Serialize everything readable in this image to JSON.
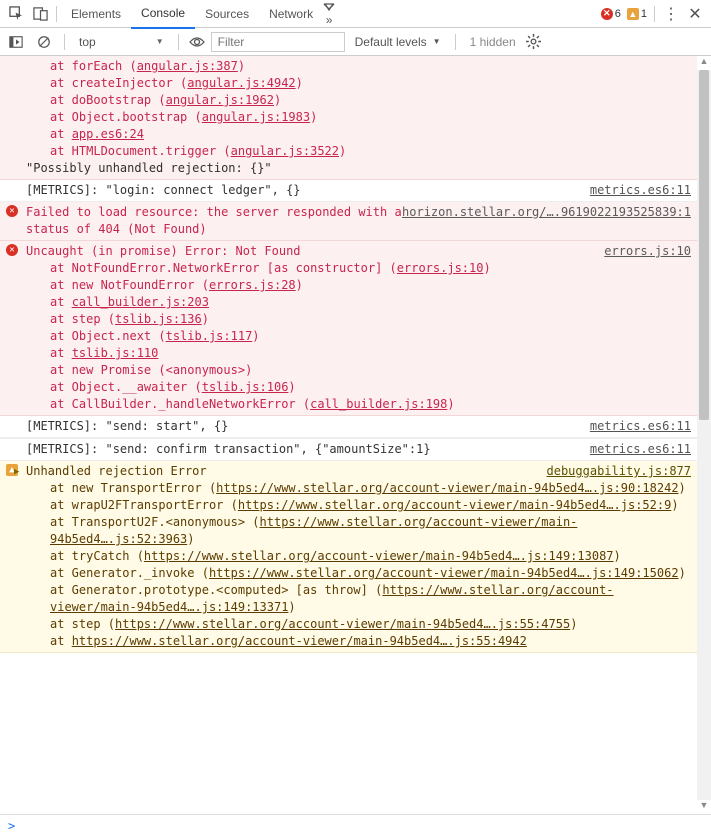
{
  "toolbar": {
    "tabs": [
      "Elements",
      "Console",
      "Sources",
      "Network"
    ],
    "active_tab": 1,
    "error_count": "6",
    "warn_count": "1"
  },
  "filterbar": {
    "context": "top",
    "filter_placeholder": "Filter",
    "levels": "Default levels",
    "hidden": "1 hidden"
  },
  "m0": {
    "l1a": "at forEach (",
    "l1b": "angular.js:387",
    "l1c": ")",
    "l2a": "at createInjector (",
    "l2b": "angular.js:4942",
    "l2c": ")",
    "l3a": "at doBootstrap (",
    "l3b": "angular.js:1962",
    "l3c": ")",
    "l4a": "at Object.bootstrap (",
    "l4b": "angular.js:1983",
    "l4c": ")",
    "l5a": "at ",
    "l5b": "app.es6:24",
    "l6a": "at HTMLDocument.trigger (",
    "l6b": "angular.js:3522",
    "l6c": ")",
    "l7": "\"Possibly unhandled rejection: {}\""
  },
  "m1": {
    "text": "[METRICS]: \"login: connect ledger\", {}",
    "src": "metrics.es6:11"
  },
  "m2": {
    "text": "Failed to load resource: the server responded with a status of 404 (Not Found)",
    "src": "horizon.stellar.org/….9619022193525839:1"
  },
  "m3": {
    "head": "Uncaught (in promise) Error: Not Found",
    "src": "errors.js:10",
    "l1a": "at NotFoundError.NetworkError [as constructor] (",
    "l1b": "errors.js:10",
    "l1c": ")",
    "l2a": "at new NotFoundError (",
    "l2b": "errors.js:28",
    "l2c": ")",
    "l3a": "at ",
    "l3b": "call_builder.js:203",
    "l4a": "at step (",
    "l4b": "tslib.js:136",
    "l4c": ")",
    "l5a": "at Object.next (",
    "l5b": "tslib.js:117",
    "l5c": ")",
    "l6a": "at ",
    "l6b": "tslib.js:110",
    "l7": "at new Promise (<anonymous>)",
    "l8a": "at Object.__awaiter (",
    "l8b": "tslib.js:106",
    "l8c": ")",
    "l9a": "at CallBuilder._handleNetworkError (",
    "l9b": "call_builder.js:198",
    "l9c": ")"
  },
  "m4": {
    "text": "[METRICS]: \"send: start\", {}",
    "src": "metrics.es6:11"
  },
  "m5": {
    "text": "[METRICS]: \"send: confirm transaction\", {\"amountSize\":1}",
    "src": "metrics.es6:11"
  },
  "m6": {
    "head": "Unhandled rejection Error",
    "src": "debuggability.js:877",
    "l1a": "at new TransportError (",
    "l1b": "https://www.stellar.org/account-viewer/main-94b5ed4….js:90:18242",
    "l1c": ")",
    "l2a": "at wrapU2FTransportError (",
    "l2b": "https://www.stellar.org/account-viewer/main-94b5ed4….js:52:9",
    "l2c": ")",
    "l3a": "at TransportU2F.<anonymous> (",
    "l3b": "https://www.stellar.org/account-viewer/main-94b5ed4….js:52:3963",
    "l3c": ")",
    "l4a": "at tryCatch (",
    "l4b": "https://www.stellar.org/account-viewer/main-94b5ed4….js:149:13087",
    "l4c": ")",
    "l5a": "at Generator._invoke (",
    "l5b": "https://www.stellar.org/account-viewer/main-94b5ed4….js:149:15062",
    "l5c": ")",
    "l6a": "at Generator.prototype.<computed> [as throw] (",
    "l6b": "https://www.stellar.org/account-viewer/main-94b5ed4….js:149:13371",
    "l6c": ")",
    "l7a": "at step (",
    "l7b": "https://www.stellar.org/account-viewer/main-94b5ed4….js:55:4755",
    "l7c": ")",
    "l8a": "at ",
    "l8b": "https://www.stellar.org/account-viewer/main-94b5ed4….js:55:4942"
  },
  "prompt": ">"
}
